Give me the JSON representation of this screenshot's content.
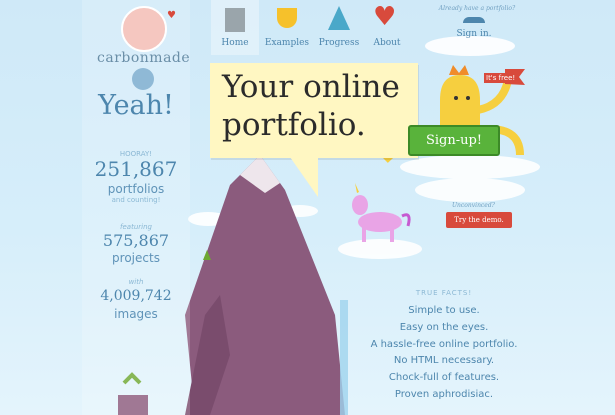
{
  "brand": {
    "name": "carbonmade"
  },
  "nav": [
    {
      "label": "Home",
      "icon": "castle-icon"
    },
    {
      "label": "Examples",
      "icon": "trophy-icon"
    },
    {
      "label": "Progress",
      "icon": "mountain-icon"
    },
    {
      "label": "About",
      "icon": "heart-icon"
    }
  ],
  "account": {
    "prompt": "Already have a portfolio?",
    "signin_label": "Sign in."
  },
  "hero": {
    "headline_line1": "Your online",
    "headline_line2": "portfolio."
  },
  "cta": {
    "flag_label": "It's free!",
    "signup_label": "Sign-up!",
    "demo_prompt": "Unconvinced?",
    "demo_label": "Try the demo."
  },
  "sidebar": {
    "greeting": "Yeah!",
    "stats_header": "HOORAY!",
    "stats": [
      {
        "value": "251,867",
        "unit": "portfolios",
        "note": "and counting!"
      },
      {
        "prefix": "featuring",
        "value": "575,867",
        "unit": "projects"
      },
      {
        "prefix": "with",
        "value": "4,009,742",
        "unit": "images"
      }
    ]
  },
  "facts": {
    "header": "TRUE FACTS!",
    "items": [
      "Simple to use.",
      "Easy on the eyes.",
      "A hassle-free online portfolio.",
      "No HTML necessary.",
      "Chock-full of features.",
      "Proven aphrodisiac."
    ]
  },
  "colors": {
    "sky": "#d6eefa",
    "accent_blue": "#4d86ad",
    "signup_green": "#59b33b",
    "demo_red": "#d84a3c",
    "bubble_yellow": "#fff7c2",
    "mountain": "#8b5b7d"
  }
}
